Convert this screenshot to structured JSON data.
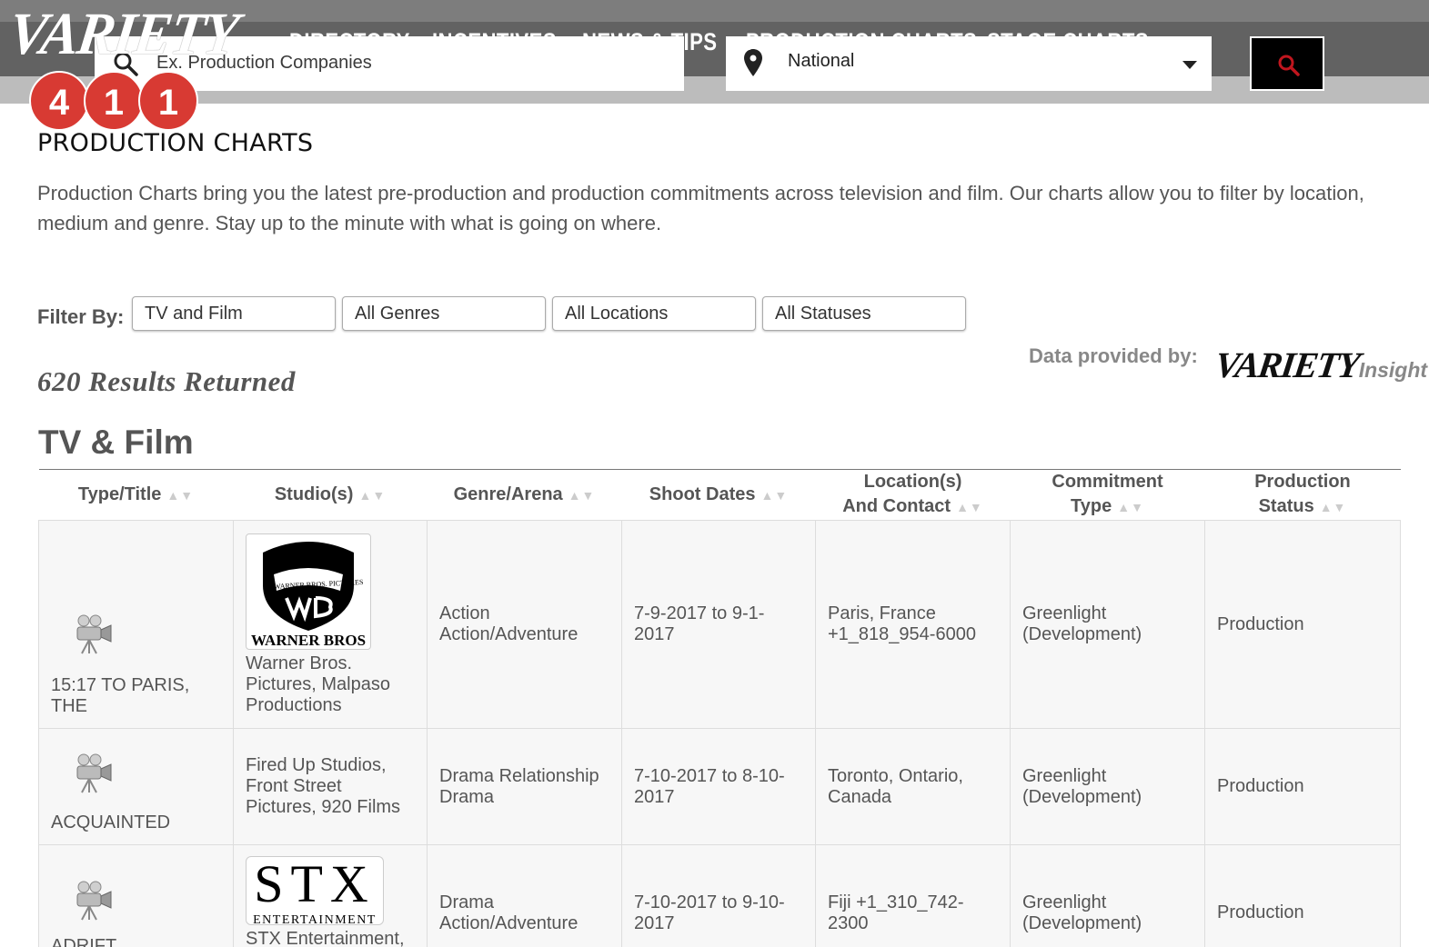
{
  "header": {
    "logo_text": "VARIETY",
    "logo_badge": [
      "4",
      "1",
      "1"
    ],
    "nav": [
      "DIRECTORY",
      "INCENTIVES",
      "NEWS & TIPS",
      "PRODUCTION CHARTS",
      "STAGE CHARTS"
    ],
    "search": {
      "placeholder": "Ex. Production Companies",
      "icon": "search-icon"
    },
    "location": {
      "value": "National",
      "icon": "map-pin-icon"
    },
    "search_button_icon": "search-icon",
    "search_button_icon_color": "#c0161e"
  },
  "page": {
    "title": "PRODUCTION CHARTS",
    "intro": "Production Charts bring you the latest pre-production and production commitments across television and film. Our charts allow you to filter by location, medium and genre. Stay up to the minute with what is going on where.",
    "filter_label": "Filter By:",
    "filters": [
      "TV and Film",
      "All Genres",
      "All Locations",
      "All Statuses"
    ],
    "provided_by": "Data provided by:",
    "provider_logo": {
      "main": "VARIETY",
      "sub": "Insight"
    },
    "results": "620 Results Returned",
    "section_title": "TV & Film"
  },
  "table": {
    "headers": [
      {
        "label": "Type/Title"
      },
      {
        "label": "Studio(s)"
      },
      {
        "label": "Genre/Arena"
      },
      {
        "label": "Shoot Dates"
      },
      {
        "label1": "Location(s)",
        "label2": "And Contact"
      },
      {
        "label1": "Commitment",
        "label2": "Type"
      },
      {
        "label1": "Production",
        "label2": "Status"
      }
    ],
    "sort_arrows": "▲▼",
    "rows": [
      {
        "type_icon": "film-camera-icon",
        "title": "15:17 TO PARIS, THE",
        "studio_logo": {
          "top": "WARNER BROS. PICTURES",
          "mark": "WB",
          "bottom": "WARNER BROS"
        },
        "studio": "Warner Bros. Pictures, Malpaso Productions",
        "genre1": "Action",
        "genre2": "Action/Adventure",
        "dates": "7-9-2017 to 9-1-2017",
        "loc1": "Paris, France",
        "loc2": "+1_818_954-6000",
        "commit1": "Greenlight",
        "commit2": "(Development)",
        "status": "Production"
      },
      {
        "type_icon": "film-camera-icon",
        "title": "ACQUAINTED",
        "studio": "Fired Up Studios, Front Street Pictures, 920 Films",
        "genre1": "Drama Relationship",
        "genre2": "Drama",
        "dates": "7-10-2017 to 8-10-2017",
        "loc1": "Toronto, Ontario, Canada",
        "loc2": "",
        "commit1": "Greenlight",
        "commit2": "(Development)",
        "status": "Production"
      },
      {
        "type_icon": "film-camera-icon",
        "title": "ADRIFT",
        "studio_logo": {
          "mark": "STX",
          "bottom": "ENTERTAINMENT"
        },
        "studio": "STX Entertainment,",
        "genre1": "Drama",
        "genre2": "Action/Adventure",
        "dates": "7-10-2017 to 9-10-2017",
        "loc1": "Fiji +1_310_742-2300",
        "loc2": "",
        "commit1": "Greenlight",
        "commit2": "(Development)",
        "status": "Production"
      }
    ]
  }
}
